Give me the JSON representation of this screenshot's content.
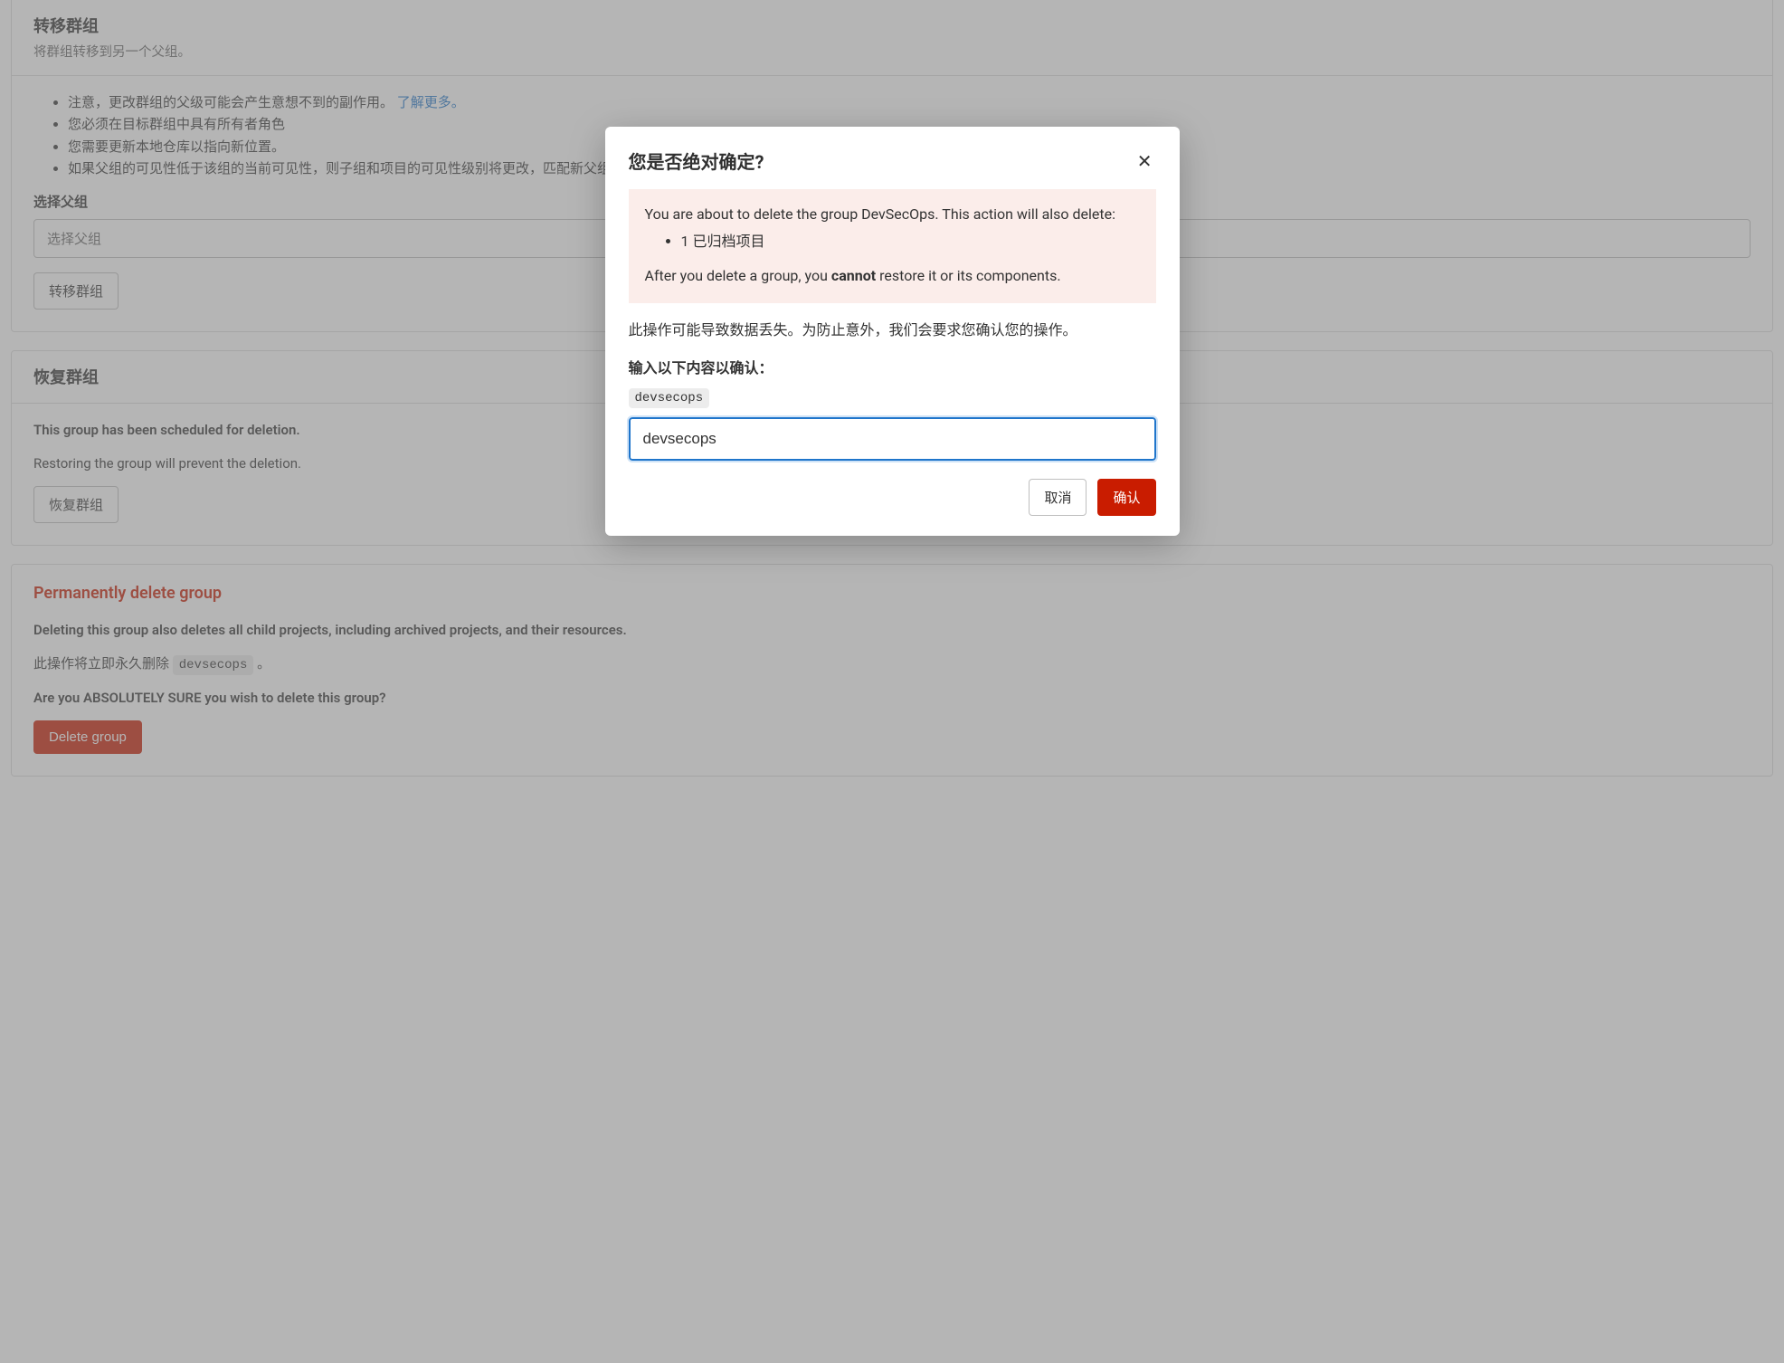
{
  "transfer": {
    "title": "转移群组",
    "subtitle": "将群组转移到另一个父组。",
    "bullets": {
      "b1_pre": "注意，更改群组的父级可能会产生意想不到的副作用。",
      "b1_link": "了解更多。",
      "b2": "您必须在目标群组中具有所有者角色",
      "b3": "您需要更新本地仓库以指向新位置。",
      "b4": "如果父组的可见性低于该组的当前可见性，则子组和项目的可见性级别将更改，匹配新父组的可见性。"
    },
    "select_label": "选择父组",
    "select_placeholder": "选择父组",
    "button": "转移群组"
  },
  "restore": {
    "title": "恢复群组",
    "scheduled": "This group has been scheduled for deletion.",
    "prevent": "Restoring the group will prevent the deletion.",
    "button": "恢复群组"
  },
  "delete": {
    "title": "Permanently delete group",
    "desc": "Deleting this group also deletes all child projects, including archived projects, and their resources.",
    "action_pre": "此操作将立即永久删除 ",
    "action_code": "devsecops",
    "action_post": " 。",
    "sure": "Are you ABSOLUTELY SURE you wish to delete this group?",
    "button": "Delete group"
  },
  "modal": {
    "title": "您是否绝对确定?",
    "warn_pre": "You are about to delete the group DevSecOps. This action will also delete:",
    "warn_item": "1 已归档项目",
    "warn_after_pre": "After you delete a group, you ",
    "warn_cannot": "cannot",
    "warn_after_post": " restore it or its components.",
    "body": "此操作可能导致数据丢失。为防止意外，我们会要求您确认您的操作。",
    "confirm_label": "输入以下内容以确认：",
    "confirm_code": "devsecops",
    "confirm_value": "devsecops",
    "cancel": "取消",
    "ok": "确认"
  }
}
